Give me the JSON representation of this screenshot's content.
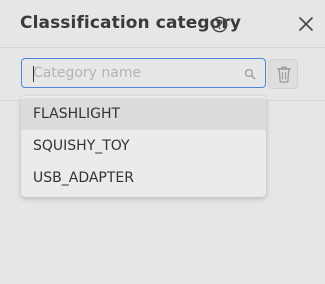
{
  "dialog": {
    "title": "Classification category"
  },
  "search": {
    "placeholder": "Category name",
    "value": ""
  },
  "options": [
    {
      "label": "FLASHLIGHT",
      "highlighted": true
    },
    {
      "label": "SQUISHY_TOY",
      "highlighted": false
    },
    {
      "label": "USB_ADAPTER",
      "highlighted": false
    }
  ],
  "colors": {
    "focus_border": "#4f86d8",
    "background": "#e6e6e6",
    "highlight": "#dcdcdc"
  }
}
